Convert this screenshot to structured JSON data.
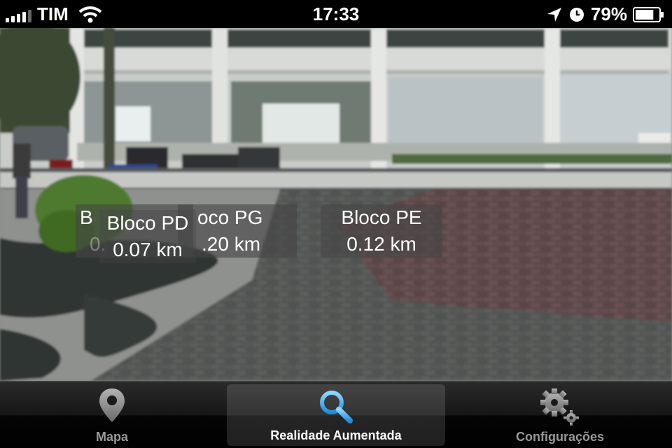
{
  "status_bar": {
    "carrier": "TIM",
    "time": "17:33",
    "battery": "79%",
    "battery_level": 0.79,
    "icons": [
      "signal-icon",
      "wifi-icon",
      "location-arrow-icon",
      "alarm-clock-icon",
      "battery-icon"
    ]
  },
  "ar_labels": [
    {
      "name": "B",
      "distance": "0."
    },
    {
      "name": "Bloco PD",
      "distance": "0.07 km"
    },
    {
      "name": "oco PG",
      "distance": ".20 km"
    },
    {
      "name": "Bloco PE",
      "distance": "0.12 km"
    }
  ],
  "tabs": [
    {
      "label": "Mapa",
      "icon": "map-pin-icon",
      "selected": false
    },
    {
      "label": "Realidade Aumentada",
      "icon": "search-icon",
      "selected": true
    },
    {
      "label": "Configurações",
      "icon": "gear-icon",
      "selected": false
    }
  ],
  "colors": {
    "selected_icon": "#4fb6f5",
    "unselected_icon": "#8e8e8e",
    "tab_bar": "#111111",
    "label_bg": "#464646"
  }
}
